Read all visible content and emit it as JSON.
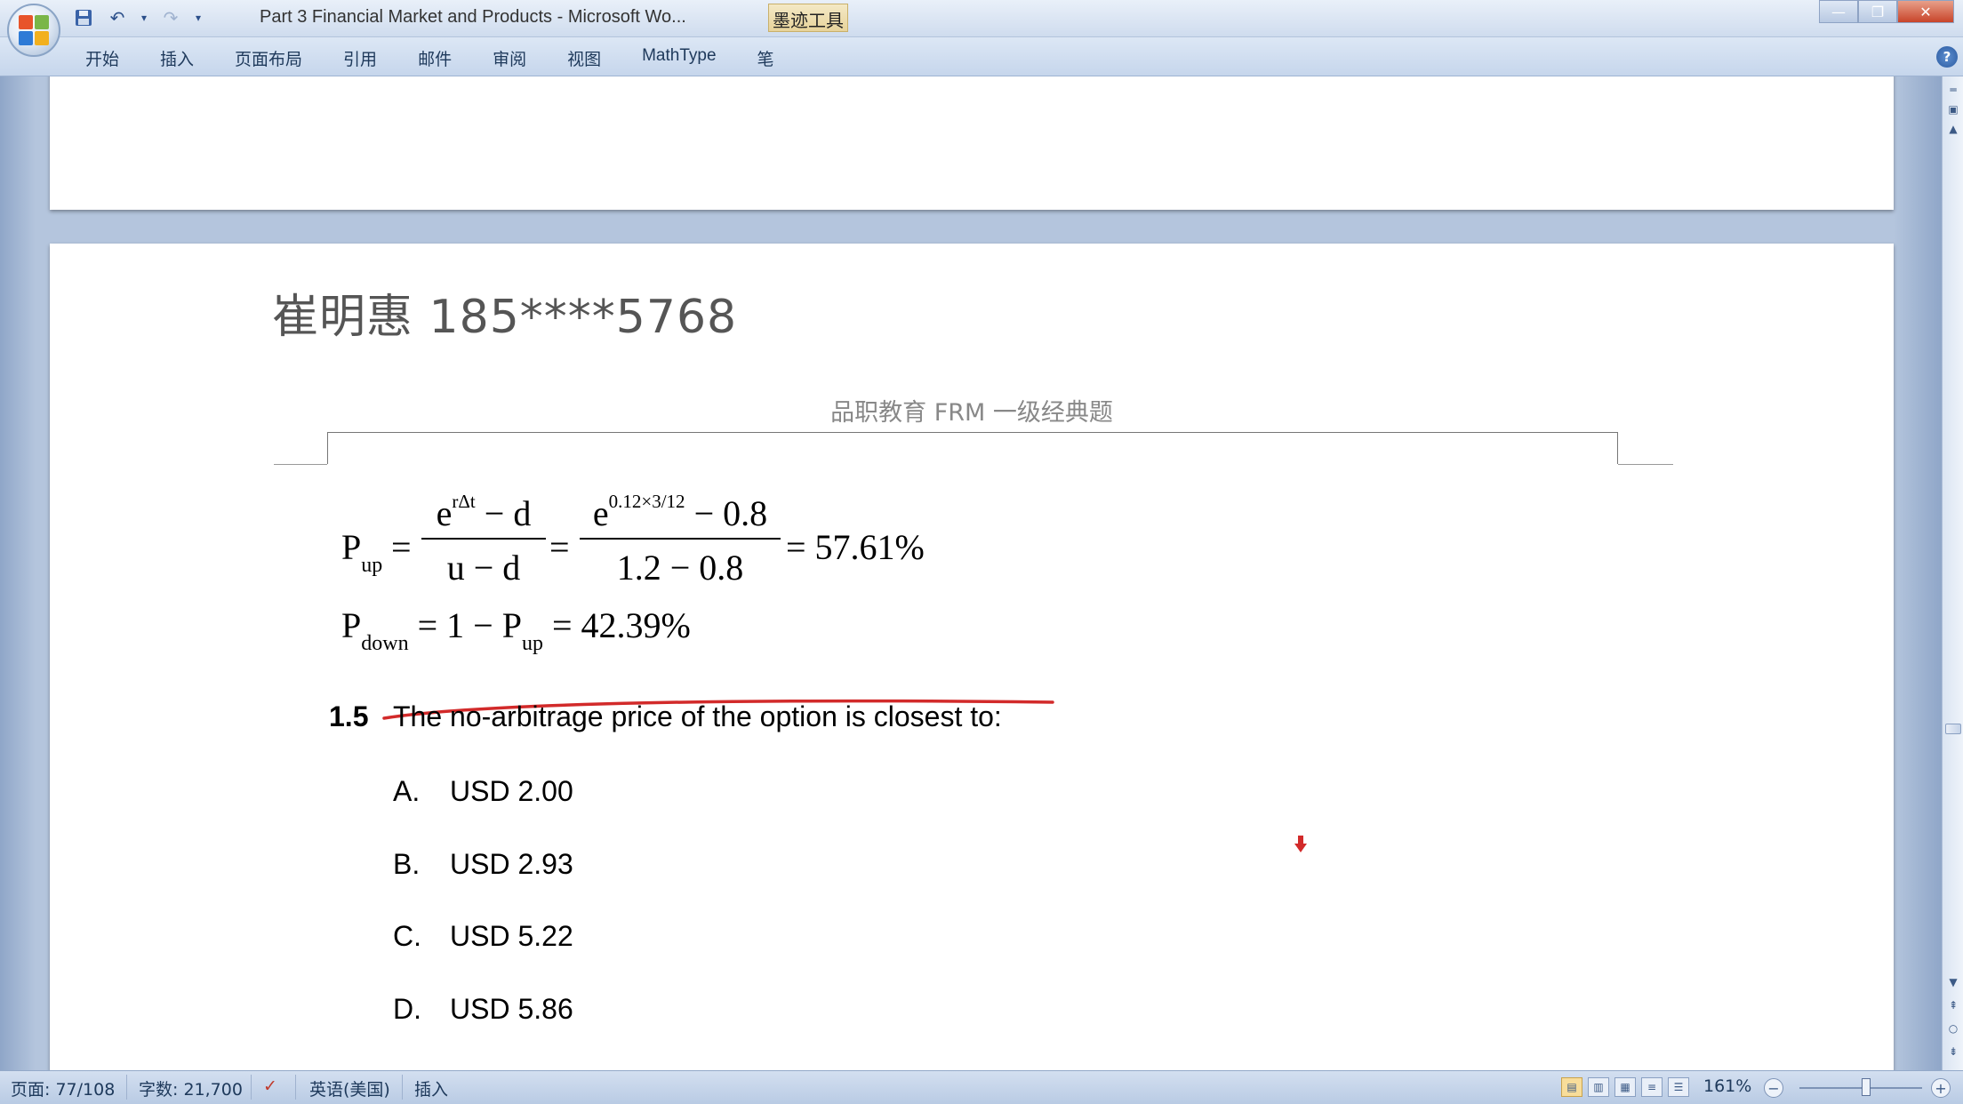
{
  "window": {
    "title": "Part 3 Financial Market and Products - Microsoft Wo...",
    "context_tab": "墨迹工具",
    "controls": {
      "minimize": "—",
      "restore": "❐",
      "close": "✕"
    }
  },
  "ribbon": {
    "tabs": [
      "开始",
      "插入",
      "页面布局",
      "引用",
      "邮件",
      "审阅",
      "视图",
      "MathType",
      "笔"
    ]
  },
  "document": {
    "watermark": "崔明惠 185****5768",
    "header": "品职教育 FRM 一级经典题",
    "formula": {
      "p_up_label": "P",
      "p_up_sub": "up",
      "eq": "=",
      "frac1_num_base": "e",
      "frac1_num_sup": "rΔt",
      "frac1_num_rest": " − d",
      "frac1_den": "u − d",
      "frac2_num_base": "e",
      "frac2_num_sup": "0.12×3/12",
      "frac2_num_rest": " − 0.8",
      "frac2_den": "1.2 − 0.8",
      "result1": "= 57.61%",
      "p_down_label": "P",
      "p_down_sub": "down",
      "line2_mid": " = 1 − P",
      "line2_sub": "up",
      "result2": " = 42.39%"
    },
    "question": {
      "number": "1.5",
      "text": "The no-arbitrage price of the option is closest to:",
      "options": [
        {
          "letter": "A.",
          "text": "USD 2.00"
        },
        {
          "letter": "B.",
          "text": "USD 2.93"
        },
        {
          "letter": "C.",
          "text": "USD 5.22"
        },
        {
          "letter": "D.",
          "text": "USD 5.86"
        }
      ]
    },
    "annotation_color": "#d22a2a"
  },
  "status": {
    "page": "页面: 77/108",
    "words": "字数: 21,700",
    "language": "英语(美国)",
    "mode": "插入",
    "zoom": "161%"
  }
}
